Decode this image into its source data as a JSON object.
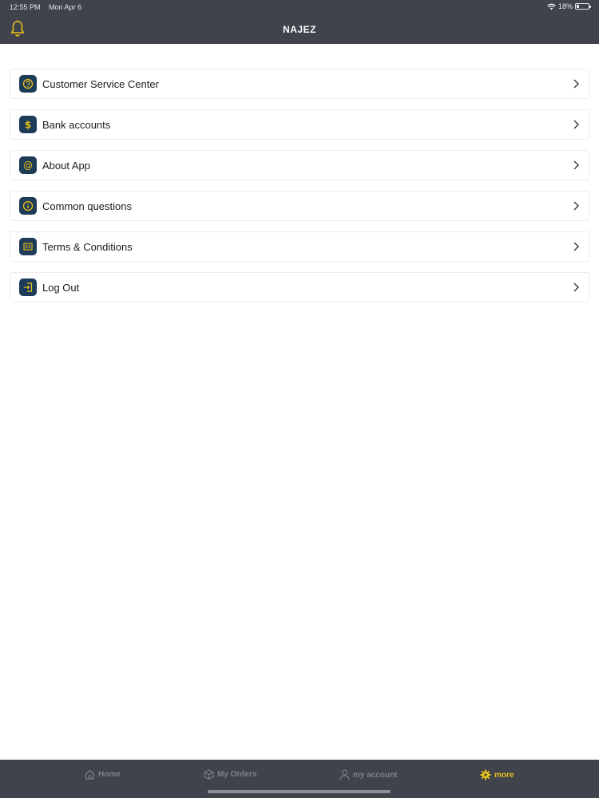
{
  "status_bar": {
    "time": "12:55 PM",
    "date": "Mon Apr 6",
    "battery": "18%"
  },
  "header": {
    "title": "NAJEZ"
  },
  "menu": {
    "items": [
      {
        "label": "Customer Service Center",
        "icon": "question-icon"
      },
      {
        "label": "Bank accounts",
        "icon": "dollar-icon"
      },
      {
        "label": "About App",
        "icon": "at-icon"
      },
      {
        "label": "Common questions",
        "icon": "info-icon"
      },
      {
        "label": "Terms & Conditions",
        "icon": "document-icon"
      },
      {
        "label": "Log Out",
        "icon": "logout-icon"
      }
    ]
  },
  "tabbar": {
    "tabs": [
      {
        "label": "Home",
        "icon": "home-icon",
        "active": false
      },
      {
        "label": "My Orders",
        "icon": "box-icon",
        "active": false
      },
      {
        "label": "my account",
        "icon": "user-icon",
        "active": false
      },
      {
        "label": "more",
        "icon": "gear-icon",
        "active": true
      }
    ]
  },
  "colors": {
    "header_bg": "#40434c",
    "icon_bg": "#1e3b57",
    "accent": "#e8c21a",
    "tab_inactive": "#7e818a"
  }
}
